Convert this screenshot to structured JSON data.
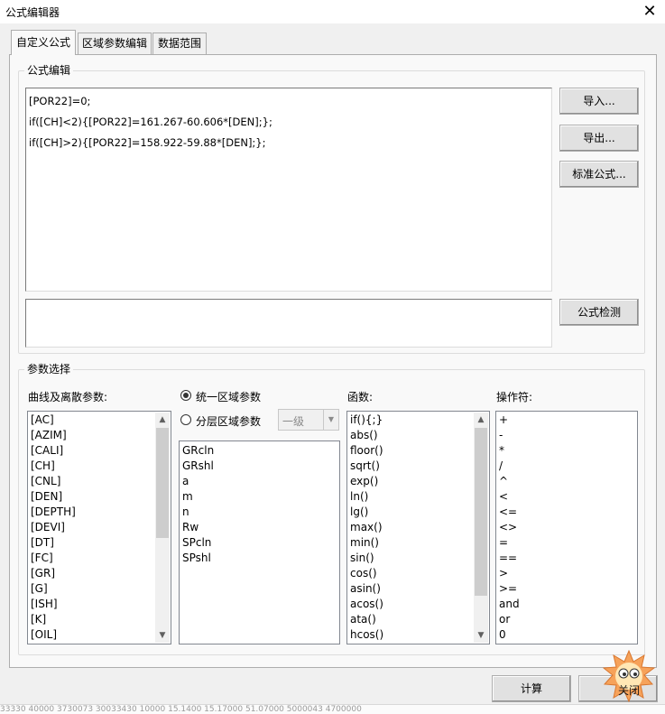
{
  "window": {
    "title": "公式编辑器",
    "close_glyph": "✕"
  },
  "tabs": [
    {
      "label": "自定义公式",
      "active": true
    },
    {
      "label": "区域参数编辑",
      "active": false
    },
    {
      "label": "数据范围",
      "active": false
    }
  ],
  "formula_editor": {
    "group_label": "公式编辑",
    "lines": [
      "[POR22]=0;",
      "if([CH]<2){[POR22]=161.267-60.606*[DEN];};",
      "if([CH]>2){[POR22]=158.922-59.88*[DEN];};"
    ],
    "check_output": "",
    "buttons": {
      "import": "导入...",
      "export": "导出...",
      "standard": "标准公式...",
      "check": "公式检测"
    }
  },
  "params": {
    "group_label": "参数选择",
    "curves_label": "曲线及离散参数:",
    "curves": [
      "[AC]",
      "[AZIM]",
      "[CALI]",
      "[CH]",
      "[CNL]",
      "[DEN]",
      "[DEPTH]",
      "[DEVI]",
      "[DT]",
      "[FC]",
      "[GR]",
      "[G]",
      "[ISH]",
      "[K]",
      "[OIL]"
    ],
    "radio_unified": "统一区域参数",
    "radio_layered": "分层区域参数",
    "radio_selected": "unified",
    "level_value": "一级",
    "region_params": [
      "GRcln",
      "GRshl",
      "a",
      "m",
      "n",
      "Rw",
      "SPcln",
      "SPshl"
    ],
    "functions_label": "函数:",
    "functions": [
      "if(){;}",
      "abs()",
      "floor()",
      "sqrt()",
      "exp()",
      "ln()",
      "lg()",
      "max()",
      "min()",
      "sin()",
      "cos()",
      "asin()",
      "acos()",
      "ata()",
      "hcos()"
    ],
    "operators_label": "操作符:",
    "operators": [
      "+",
      "-",
      "*",
      "/",
      "^",
      "<",
      "<=",
      "<>",
      "=",
      "==",
      ">",
      ">=",
      "and",
      "or",
      "0"
    ]
  },
  "footer": {
    "compute": "计算",
    "close": "关闭"
  },
  "background_numbers": "33330   40000   3730073   30033430   10000   15.1400   15.17000   51.07000   5000043   4700000"
}
